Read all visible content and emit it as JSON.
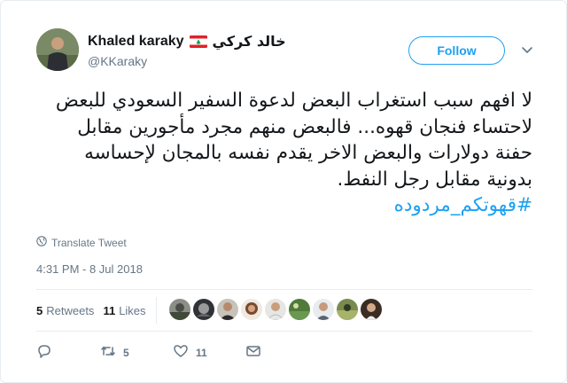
{
  "author": {
    "display_name": "Khaled karaky",
    "arabic_name": "خالد كركي",
    "handle": "@KKaraky",
    "flag_icon": "lebanon-flag-icon"
  },
  "follow_button": {
    "label": "Follow"
  },
  "tweet": {
    "lines": [
      "لا افهم سبب استغراب البعض لدعوة السفير السعودي للبعض",
      "لاحتساء فنجان قهوه... فالبعض منهم مجرد مأجورين مقابل",
      "حفنة دولارات والبعض الاخر يقدم نفسه بالمجان لإحساسه",
      "بدونية مقابل رجل النفط."
    ],
    "hashtag": "#قهوتكم_مردوده"
  },
  "translate": {
    "label": "Translate Tweet",
    "icon": "globe-icon"
  },
  "timestamp": "4:31 PM - 8 Jul 2018",
  "stats": {
    "retweets_count": "5",
    "retweets_label": "Retweets",
    "likes_count": "11",
    "likes_label": "Likes"
  },
  "liker_avatars_count": 9,
  "actions": {
    "reply_icon": "reply-icon",
    "retweet_icon": "retweet-icon",
    "retweet_count": "5",
    "like_icon": "heart-icon",
    "like_count": "11"
  },
  "colors": {
    "accent": "#1da1f2",
    "secondary_text": "#657786",
    "primary_text": "#14171a",
    "flag_red": "#e3202a",
    "flag_green": "#00a651"
  }
}
